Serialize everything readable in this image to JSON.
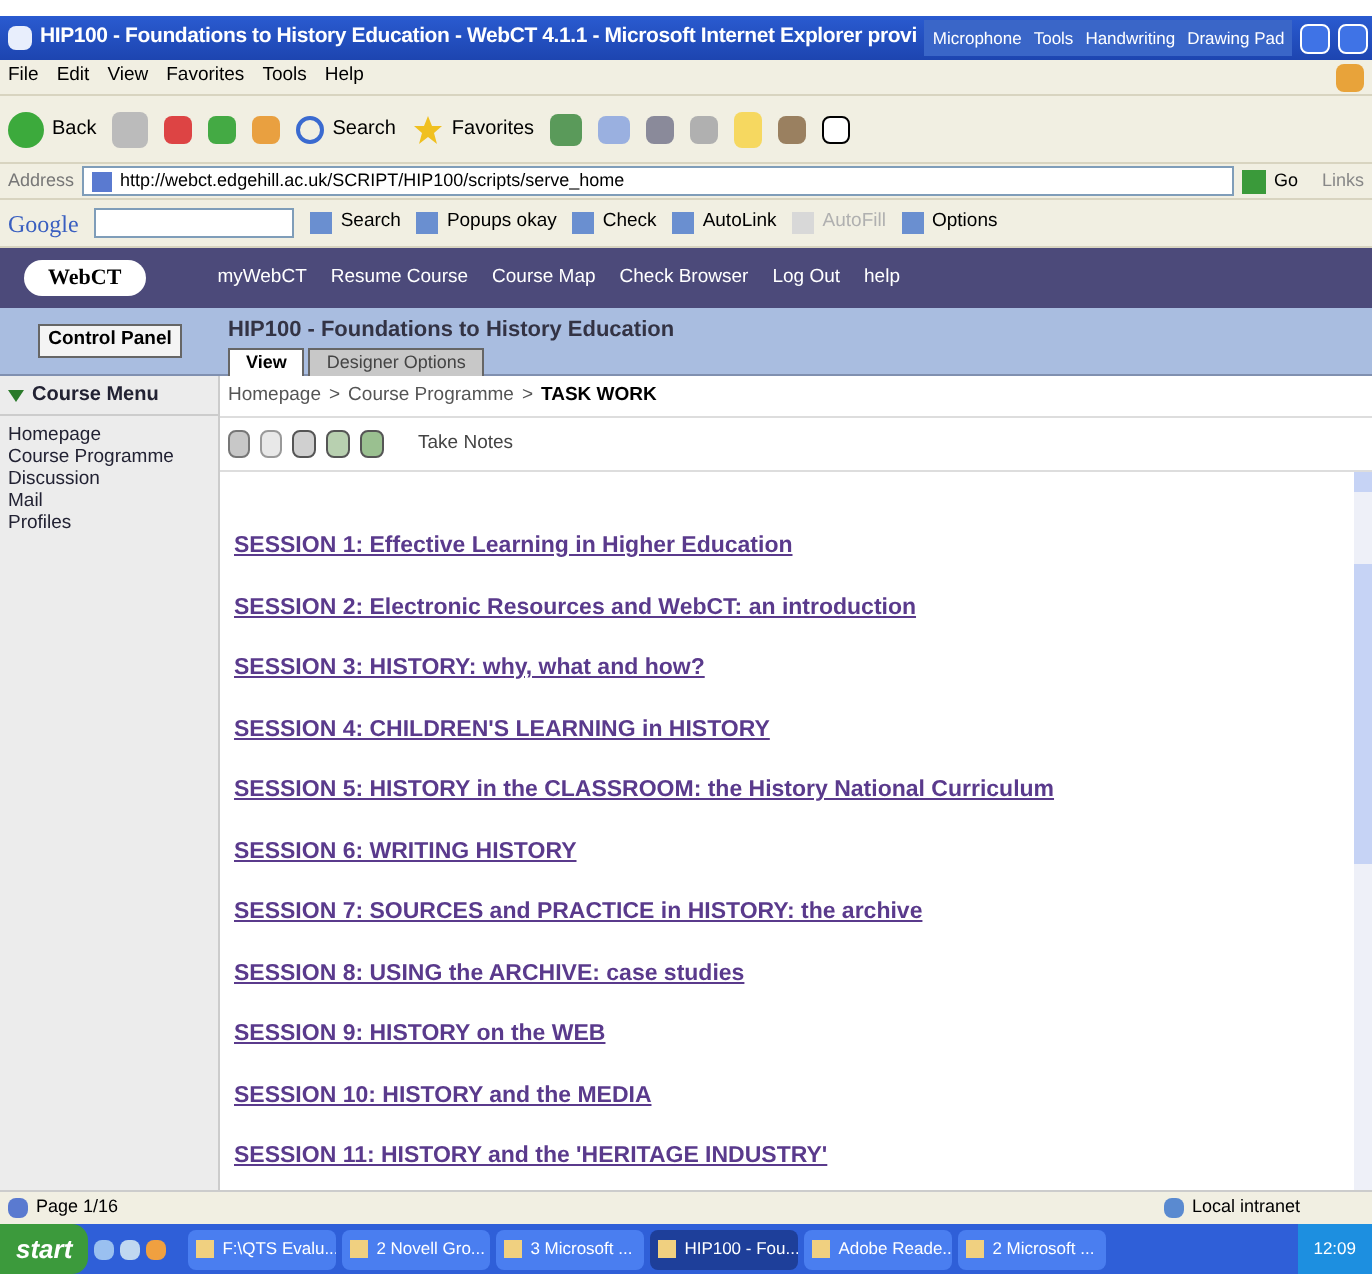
{
  "window": {
    "title": "HIP100 - Foundations to History Education - WebCT 4.1.1 - Microsoft Internet Explorer provi"
  },
  "language_bar": [
    "Microphone",
    "Tools",
    "Handwriting",
    "Drawing Pad"
  ],
  "menu": [
    "File",
    "Edit",
    "View",
    "Favorites",
    "Tools",
    "Help"
  ],
  "toolbar": {
    "back": "Back",
    "search": "Search",
    "favorites": "Favorites"
  },
  "address_bar": {
    "label": "Address",
    "url": "http://webct.edgehill.ac.uk/SCRIPT/HIP100/scripts/serve_home",
    "go": "Go",
    "links": "Links"
  },
  "google_toolbar": {
    "logo": "Google",
    "items": [
      {
        "label": "Search",
        "disabled": false
      },
      {
        "label": "Popups okay",
        "disabled": false
      },
      {
        "label": "Check",
        "disabled": false
      },
      {
        "label": "AutoLink",
        "disabled": false
      },
      {
        "label": "AutoFill",
        "disabled": true
      },
      {
        "label": "Options",
        "disabled": false
      }
    ]
  },
  "webct_nav": {
    "logo": "WebCT",
    "links": [
      "myWebCT",
      "Resume Course",
      "Course Map",
      "Check Browser",
      "Log Out",
      "help"
    ]
  },
  "course": {
    "control_panel": "Control Panel",
    "title": "HIP100 - Foundations to History Education",
    "tabs": [
      {
        "label": "View",
        "selected": true
      },
      {
        "label": "Designer Options",
        "selected": false
      }
    ]
  },
  "course_menu": {
    "title": "Course Menu",
    "expanded": true,
    "items": [
      "Homepage",
      "Course Programme",
      "Discussion",
      "Mail",
      "Profiles"
    ]
  },
  "breadcrumb": {
    "items": [
      "Homepage",
      "Course Programme",
      "TASK WORK"
    ],
    "separator": ">"
  },
  "page_tools": {
    "take_notes": "Take Notes"
  },
  "sessions": [
    "SESSION 1: Effective Learning in Higher Education",
    "SESSION 2: Electronic Resources and WebCT: an introduction",
    "SESSION 3: HISTORY: why, what and how?",
    "SESSION 4: CHILDREN'S LEARNING in HISTORY",
    "SESSION 5: HISTORY in the CLASSROOM: the History National Curriculum",
    "SESSION 6: WRITING HISTORY",
    "SESSION 7: SOURCES and PRACTICE in HISTORY: the archive",
    "SESSION 8: USING the ARCHIVE: case studies",
    "SESSION 9: HISTORY on the WEB",
    "SESSION 10: HISTORY and the MEDIA",
    "SESSION 11: HISTORY and the 'HERITAGE INDUSTRY'"
  ],
  "status_bar": {
    "page": "Page 1/16",
    "zone": "Local intranet"
  },
  "taskbar": {
    "start": "start",
    "tasks": [
      {
        "label": "F:\\QTS Evalu...",
        "selected": false
      },
      {
        "label": "2 Novell Gro...",
        "selected": false
      },
      {
        "label": "3 Microsoft ...",
        "selected": false
      },
      {
        "label": "HIP100 - Fou...",
        "selected": true
      },
      {
        "label": "Adobe Reade...",
        "selected": false
      },
      {
        "label": "2 Microsoft ...",
        "selected": false
      }
    ],
    "clock": "12:09"
  }
}
